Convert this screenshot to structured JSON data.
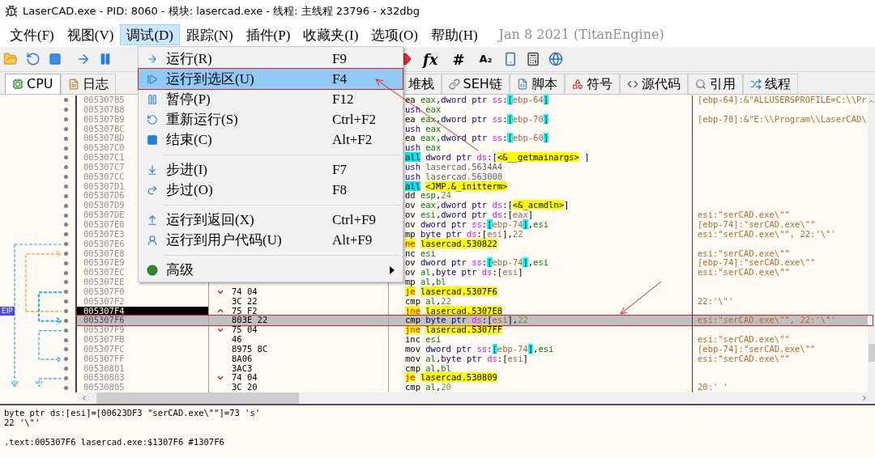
{
  "window": {
    "title": "LaserCAD.exe - PID: 8060 - 模块: lasercad.exe - 线程: 主线程 23796 - x32dbg"
  },
  "menubar": {
    "items": [
      {
        "label": "文件(F)",
        "selected": false
      },
      {
        "label": "视图(V)",
        "selected": false
      },
      {
        "label": "调试(D)",
        "selected": true
      },
      {
        "label": "跟踪(N)",
        "selected": false
      },
      {
        "label": "插件(P)",
        "selected": false
      },
      {
        "label": "收藏夹(I)",
        "selected": false
      },
      {
        "label": "选项(O)",
        "selected": false
      },
      {
        "label": "帮助(H)",
        "selected": false
      }
    ],
    "build": "Jan 8 2021 (TitanEngine)"
  },
  "toolbar": {
    "glyphs": [
      "fx",
      "#",
      "A₂"
    ]
  },
  "tabs": [
    {
      "label": "CPU",
      "selected": true
    },
    {
      "label": "日志",
      "selected": false
    },
    {
      "label": "堆栈",
      "selected": false
    },
    {
      "label": "SEH链",
      "selected": false
    },
    {
      "label": "脚本",
      "selected": false
    },
    {
      "label": "符号",
      "selected": false
    },
    {
      "label": "源代码",
      "selected": false
    },
    {
      "label": "引用",
      "selected": false
    },
    {
      "label": "线程",
      "selected": false
    }
  ],
  "debug_menu": [
    {
      "kind": "item",
      "label": "运行(R)",
      "shortcut": "F9",
      "selected": false
    },
    {
      "kind": "item",
      "label": "运行到选区(U)",
      "shortcut": "F4",
      "selected": true
    },
    {
      "kind": "item",
      "label": "暂停(P)",
      "shortcut": "F12",
      "selected": false
    },
    {
      "kind": "item",
      "label": "重新运行(S)",
      "shortcut": "Ctrl+F2",
      "selected": false
    },
    {
      "kind": "item",
      "label": "结束(C)",
      "shortcut": "Alt+F2",
      "selected": false
    },
    {
      "kind": "separator"
    },
    {
      "kind": "item",
      "label": "步进(I)",
      "shortcut": "F7",
      "selected": false
    },
    {
      "kind": "item",
      "label": "步过(O)",
      "shortcut": "F8",
      "selected": false
    },
    {
      "kind": "separator"
    },
    {
      "kind": "item",
      "label": "运行到返回(X)",
      "shortcut": "Ctrl+F9",
      "selected": false
    },
    {
      "kind": "item",
      "label": "运行到用户代码(U)",
      "shortcut": "Alt+F9",
      "selected": false
    },
    {
      "kind": "separator"
    },
    {
      "kind": "submenu",
      "label": "高级",
      "selected": false
    }
  ],
  "disassembly": {
    "eip_label": "EIP",
    "rows": [
      {
        "address": "005307B5",
        "asm": [
          {
            "text": "ea ",
            "kind": "mn"
          },
          {
            "text": "eax",
            "kind": "reg"
          },
          {
            "text": ",",
            "kind": "p"
          },
          {
            "text": "dword ptr ",
            "kind": "ptr"
          },
          {
            "text": "ss",
            "kind": "seg"
          },
          {
            "text": ":",
            "kind": "p"
          },
          {
            "text": "[",
            "kind": "br"
          },
          {
            "text": "ebp-64",
            "kind": "mem"
          },
          {
            "text": "]",
            "kind": "br"
          }
        ],
        "comment": "[ebp-64]:&\"ALLUSERSPROFILE=C:\\\\Pr",
        "selected": false,
        "eip": false
      },
      {
        "address": "005307B8",
        "asm": [
          {
            "text": "ush ",
            "kind": "push"
          },
          {
            "text": "eax",
            "kind": "reg"
          }
        ],
        "selected": false,
        "eip": false
      },
      {
        "address": "005307B9",
        "asm": [
          {
            "text": "ea ",
            "kind": "mn"
          },
          {
            "text": "eax",
            "kind": "reg"
          },
          {
            "text": ",",
            "kind": "p"
          },
          {
            "text": "dword ptr ",
            "kind": "ptr"
          },
          {
            "text": "ss",
            "kind": "seg"
          },
          {
            "text": ":",
            "kind": "p"
          },
          {
            "text": "[",
            "kind": "br"
          },
          {
            "text": "ebp-70",
            "kind": "mem"
          },
          {
            "text": "]",
            "kind": "br"
          }
        ],
        "comment": "[ebp-70]:&\"E:\\\\Program\\\\LaserCAD\\",
        "selected": false,
        "eip": false
      },
      {
        "address": "005307BC",
        "asm": [
          {
            "text": "ush ",
            "kind": "push"
          },
          {
            "text": "eax",
            "kind": "reg"
          }
        ],
        "selected": false,
        "eip": false
      },
      {
        "address": "005307BD",
        "asm": [
          {
            "text": "ea ",
            "kind": "mn"
          },
          {
            "text": "eax",
            "kind": "reg"
          },
          {
            "text": ",",
            "kind": "p"
          },
          {
            "text": "dword ptr ",
            "kind": "ptr"
          },
          {
            "text": "ss",
            "kind": "seg"
          },
          {
            "text": ":",
            "kind": "p"
          },
          {
            "text": "[",
            "kind": "br"
          },
          {
            "text": "ebp-60",
            "kind": "mem"
          },
          {
            "text": "]",
            "kind": "br"
          }
        ],
        "selected": false,
        "eip": false
      },
      {
        "address": "005307C0",
        "asm": [
          {
            "text": "ush ",
            "kind": "push"
          },
          {
            "text": "eax",
            "kind": "reg"
          }
        ],
        "selected": false,
        "eip": false
      },
      {
        "address": "005307C1",
        "asm": [
          {
            "text": "all",
            "kind": "call"
          },
          {
            "text": "dword ptr ",
            "kind": "ptr"
          },
          {
            "text": "ds",
            "kind": "seg"
          },
          {
            "text": ":[",
            "kind": "p"
          },
          {
            "text": "<&__getmainargs>",
            "kind": "label"
          },
          {
            "text": " ]",
            "kind": "p"
          }
        ],
        "selected": false,
        "eip": false
      },
      {
        "address": "005307C7",
        "asm": [
          {
            "text": "ush ",
            "kind": "push"
          },
          {
            "text": "lasercad.5634A4",
            "kind": "const"
          }
        ],
        "selected": false,
        "eip": false
      },
      {
        "address": "005307CC",
        "asm": [
          {
            "text": "ush ",
            "kind": "push"
          },
          {
            "text": "lasercad.563000",
            "kind": "const"
          }
        ],
        "selected": false,
        "eip": false
      },
      {
        "address": "005307D1",
        "asm": [
          {
            "text": "all",
            "kind": "call"
          },
          {
            "text": "<JMP.&_initterm>",
            "kind": "label"
          }
        ],
        "selected": false,
        "eip": false
      },
      {
        "address": "005307D6",
        "asm": [
          {
            "text": "dd ",
            "kind": "mn"
          },
          {
            "text": "esp",
            "kind": "reg"
          },
          {
            "text": ",",
            "kind": "p"
          },
          {
            "text": "24",
            "kind": "num"
          }
        ],
        "selected": false,
        "eip": false
      },
      {
        "address": "005307D9",
        "asm": [
          {
            "text": "ov ",
            "kind": "mn"
          },
          {
            "text": "eax",
            "kind": "reg"
          },
          {
            "text": ",",
            "kind": "p"
          },
          {
            "text": "dword ptr ",
            "kind": "ptr"
          },
          {
            "text": "ds",
            "kind": "seg"
          },
          {
            "text": ":[",
            "kind": "p"
          },
          {
            "text": "<&_acmdln>",
            "kind": "label"
          },
          {
            "text": "]",
            "kind": "p"
          }
        ],
        "selected": false,
        "eip": false
      },
      {
        "address": "005307DE",
        "asm": [
          {
            "text": "ov ",
            "kind": "mn"
          },
          {
            "text": "esi",
            "kind": "reg"
          },
          {
            "text": ",",
            "kind": "p"
          },
          {
            "text": "dword ptr ",
            "kind": "ptr"
          },
          {
            "text": "ds",
            "kind": "seg"
          },
          {
            "text": ":[",
            "kind": "p"
          },
          {
            "text": "eax",
            "kind": "mem"
          },
          {
            "text": "]",
            "kind": "p"
          }
        ],
        "comment": "esi:\"serCAD.exe\\\"\"",
        "selected": false,
        "eip": false
      },
      {
        "address": "005307E0",
        "asm": [
          {
            "text": "ov ",
            "kind": "mn"
          },
          {
            "text": "dword ptr ",
            "kind": "ptr"
          },
          {
            "text": "ss",
            "kind": "seg"
          },
          {
            "text": ":",
            "kind": "p"
          },
          {
            "text": "[",
            "kind": "br"
          },
          {
            "text": "ebp-74",
            "kind": "mem"
          },
          {
            "text": "]",
            "kind": "br"
          },
          {
            "text": ",",
            "kind": "p"
          },
          {
            "text": "esi",
            "kind": "reg"
          }
        ],
        "comment": "[ebp-74]:\"serCAD.exe\\\"\"",
        "selected": false,
        "eip": false
      },
      {
        "address": "005307E3",
        "asm": [
          {
            "text": "mp ",
            "kind": "mn"
          },
          {
            "text": "byte ptr ",
            "kind": "ptr"
          },
          {
            "text": "ds",
            "kind": "seg"
          },
          {
            "text": ":[",
            "kind": "p"
          },
          {
            "text": "esi",
            "kind": "mem"
          },
          {
            "text": "],",
            "kind": "p"
          },
          {
            "text": "22",
            "kind": "num"
          }
        ],
        "comment": "esi:\"serCAD.exe\\\"\", 22:'\\\"'",
        "selected": false,
        "eip": false
      },
      {
        "address": "005307E6",
        "asm": [
          {
            "text": "ne",
            "kind": "jcc"
          },
          {
            "text": "lasercad.530822",
            "kind": "addr"
          }
        ],
        "selected": false,
        "eip": false
      },
      {
        "address": "005307E8",
        "asm": [
          {
            "text": "nc ",
            "kind": "mn"
          },
          {
            "text": "esi",
            "kind": "reg"
          }
        ],
        "comment": "esi:\"serCAD.exe\\\"\"",
        "selected": false,
        "eip": false
      },
      {
        "address": "005307E9",
        "asm": [
          {
            "text": "ov ",
            "kind": "mn"
          },
          {
            "text": "dword ptr ",
            "kind": "ptr"
          },
          {
            "text": "ss",
            "kind": "seg"
          },
          {
            "text": ":",
            "kind": "p"
          },
          {
            "text": "[",
            "kind": "br"
          },
          {
            "text": "ebp-74",
            "kind": "mem"
          },
          {
            "text": "]",
            "kind": "br"
          },
          {
            "text": ",",
            "kind": "p"
          },
          {
            "text": "esi",
            "kind": "reg"
          }
        ],
        "comment": "[ebp-74]:\"serCAD.exe\\\"\"",
        "selected": false,
        "eip": false
      },
      {
        "address": "005307EC",
        "asm": [
          {
            "text": "ov ",
            "kind": "mn"
          },
          {
            "text": "al",
            "kind": "reg"
          },
          {
            "text": ",",
            "kind": "p"
          },
          {
            "text": "byte ptr ",
            "kind": "ptr"
          },
          {
            "text": "ds",
            "kind": "seg"
          },
          {
            "text": ":[",
            "kind": "p"
          },
          {
            "text": "esi",
            "kind": "mem"
          },
          {
            "text": "]",
            "kind": "p"
          }
        ],
        "comment": "esi:\"serCAD.exe\\\"\"",
        "selected": false,
        "eip": false
      },
      {
        "address": "005307EE",
        "asm": [
          {
            "text": "mp ",
            "kind": "mn"
          },
          {
            "text": "al",
            "kind": "reg"
          },
          {
            "text": ",",
            "kind": "p"
          },
          {
            "text": "bl",
            "kind": "reg"
          }
        ],
        "selected": false,
        "eip": false
      },
      {
        "address": "005307F0",
        "bytes": "74 04",
        "branch_up": false,
        "asm": [
          {
            "text": "je",
            "kind": "jcc"
          },
          {
            "text": "lasercad.5307F6",
            "kind": "addr"
          }
        ],
        "selected": false,
        "eip": false
      },
      {
        "address": "005307F2",
        "bytes": "3C 22",
        "asm": [
          {
            "text": "cmp ",
            "kind": "mn"
          },
          {
            "text": "al",
            "kind": "reg"
          },
          {
            "text": ",",
            "kind": "p"
          },
          {
            "text": "22",
            "kind": "num"
          }
        ],
        "comment": "22:'\\\"'",
        "selected": false,
        "eip": false
      },
      {
        "address": "005307F4",
        "bytes": "75 F2",
        "branch_up": true,
        "asm": [
          {
            "text": "jne",
            "kind": "jcc"
          },
          {
            "text": "lasercad.5307E8",
            "kind": "addr"
          }
        ],
        "selected": false,
        "eip": true
      },
      {
        "address": "005307F6",
        "bytes": "803E 22",
        "asm": [
          {
            "text": "cmp ",
            "kind": "mn"
          },
          {
            "text": "byte ptr ",
            "kind": "ptr"
          },
          {
            "text": "ds",
            "kind": "seg"
          },
          {
            "text": ":[",
            "kind": "p"
          },
          {
            "text": "esi",
            "kind": "mem"
          },
          {
            "text": "],",
            "kind": "p"
          },
          {
            "text": "22",
            "kind": "num"
          }
        ],
        "comment": "esi:\"serCAD.exe\\\"\", 22:'\\\"'",
        "selected": true,
        "eip": false
      },
      {
        "address": "005307F9",
        "bytes": "75 04",
        "branch_up": false,
        "asm": [
          {
            "text": "jne",
            "kind": "jcc"
          },
          {
            "text": "lasercad.5307FF",
            "kind": "addr"
          }
        ],
        "selected": false,
        "eip": false
      },
      {
        "address": "005307FB",
        "bytes": "46",
        "asm": [
          {
            "text": "inc ",
            "kind": "mn"
          },
          {
            "text": "esi",
            "kind": "reg"
          }
        ],
        "comment": "esi:\"serCAD.exe\\\"\"",
        "selected": false,
        "eip": false
      },
      {
        "address": "005307FC",
        "bytes": "8975 8C",
        "asm": [
          {
            "text": "mov ",
            "kind": "mn"
          },
          {
            "text": "dword ptr ",
            "kind": "ptr"
          },
          {
            "text": "ss",
            "kind": "seg"
          },
          {
            "text": ":",
            "kind": "p"
          },
          {
            "text": "[",
            "kind": "br"
          },
          {
            "text": "ebp-74",
            "kind": "mem"
          },
          {
            "text": "]",
            "kind": "br"
          },
          {
            "text": ",",
            "kind": "p"
          },
          {
            "text": "esi",
            "kind": "reg"
          }
        ],
        "comment": "[ebp-74]:\"serCAD.exe\\\"\"",
        "selected": false,
        "eip": false
      },
      {
        "address": "005307FF",
        "bytes": "8A06",
        "asm": [
          {
            "text": "mov ",
            "kind": "mn"
          },
          {
            "text": "al",
            "kind": "reg"
          },
          {
            "text": ",",
            "kind": "p"
          },
          {
            "text": "byte ptr ",
            "kind": "ptr"
          },
          {
            "text": "ds",
            "kind": "seg"
          },
          {
            "text": ":[",
            "kind": "p"
          },
          {
            "text": "esi",
            "kind": "mem"
          },
          {
            "text": "]",
            "kind": "p"
          }
        ],
        "comment": "esi:\"serCAD.exe\\\"\"",
        "selected": false,
        "eip": false
      },
      {
        "address": "00530801",
        "bytes": "3AC3",
        "asm": [
          {
            "text": "cmp ",
            "kind": "mn"
          },
          {
            "text": "al",
            "kind": "reg"
          },
          {
            "text": ",",
            "kind": "p"
          },
          {
            "text": "bl",
            "kind": "reg"
          }
        ],
        "selected": false,
        "eip": false
      },
      {
        "address": "00530803",
        "bytes": "74 04",
        "branch_up": false,
        "asm": [
          {
            "text": "je",
            "kind": "jcc"
          },
          {
            "text": "lasercad.530809",
            "kind": "addr"
          }
        ],
        "selected": false,
        "eip": false
      },
      {
        "address": "00530805",
        "bytes": "3C 20",
        "asm": [
          {
            "text": "cmp ",
            "kind": "mn"
          },
          {
            "text": "al",
            "kind": "reg"
          },
          {
            "text": ",",
            "kind": "p"
          },
          {
            "text": "20",
            "kind": "num"
          }
        ],
        "comment": "20:' '",
        "selected": false,
        "eip": false
      }
    ]
  },
  "info_panel": [
    "byte ptr ds:[esi]=[00623DF3 \"serCAD.exe\\\"\"]=73 's'",
    "22 '\\\"'",
    ".text:005307F6 lasercad.exe:$1307F6 #1307F6"
  ]
}
